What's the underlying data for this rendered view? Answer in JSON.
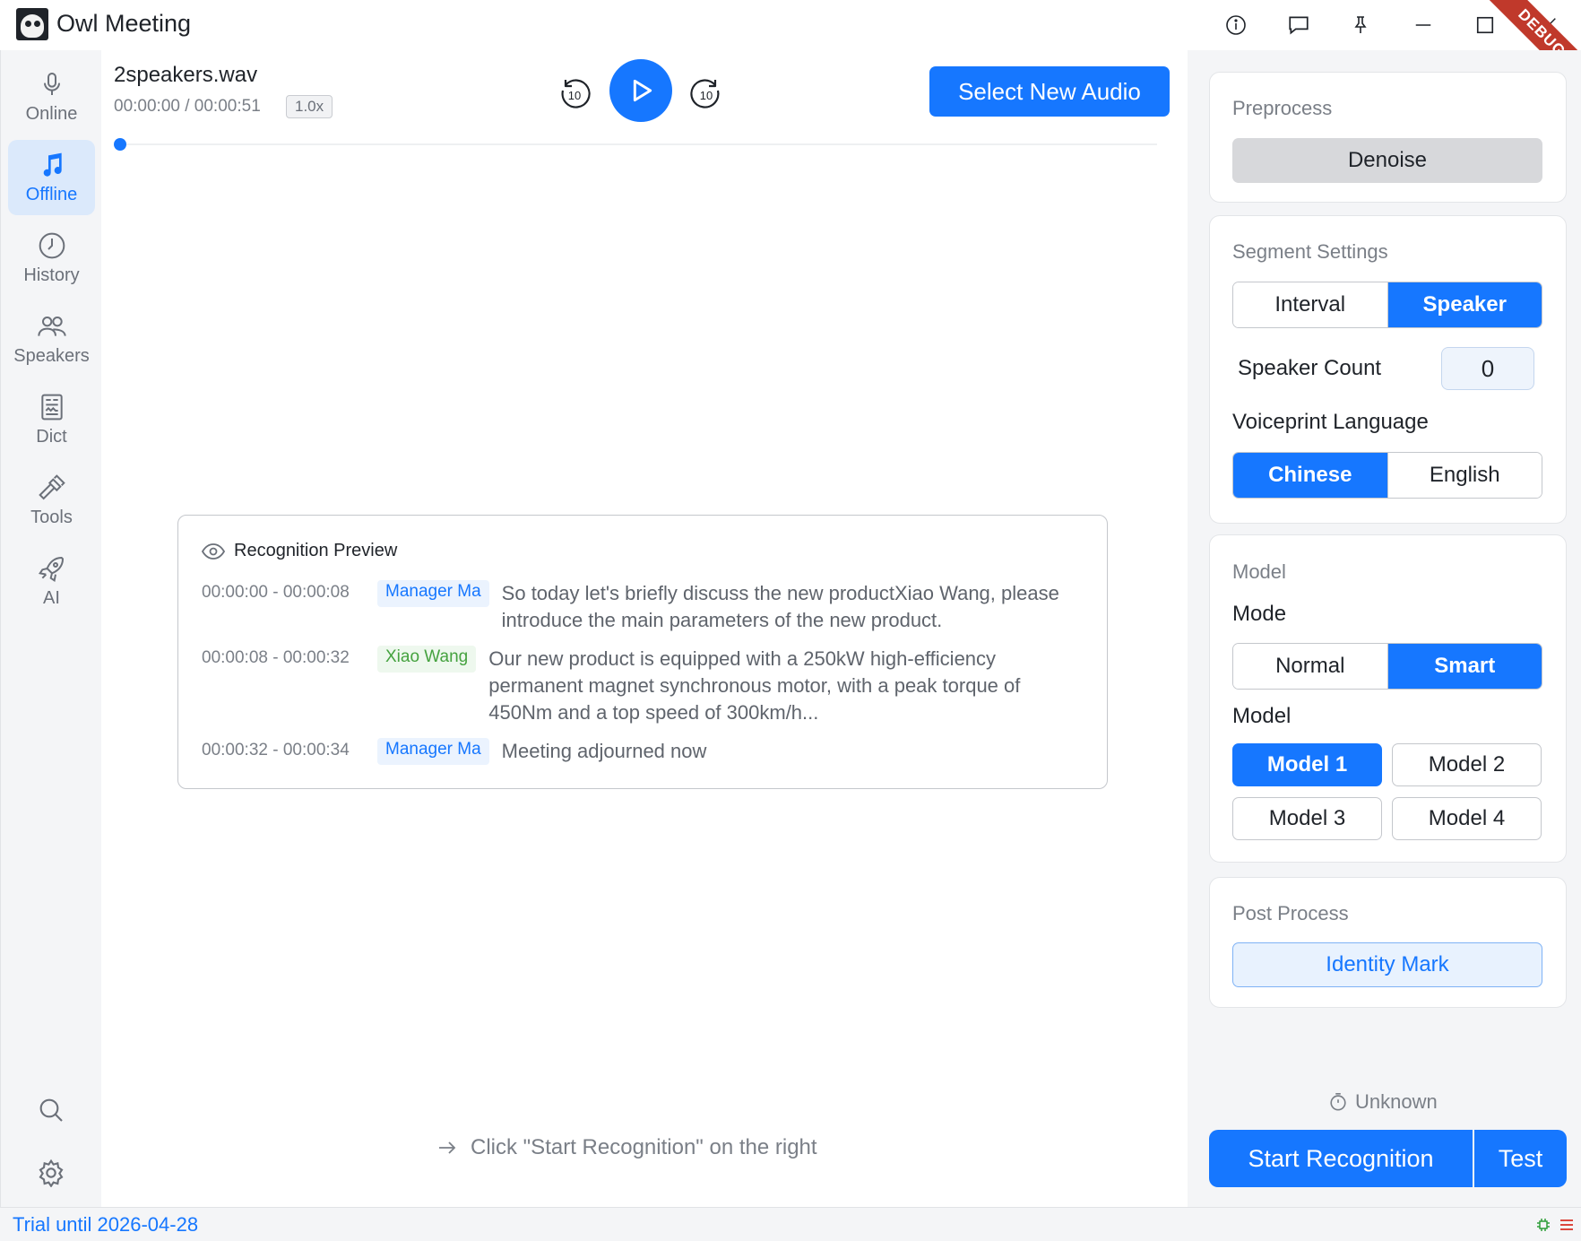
{
  "app": {
    "title": "Owl Meeting",
    "debug_label": "DEBUG"
  },
  "titlebar": {
    "icons": [
      "info-icon",
      "message-icon",
      "pin-icon",
      "minimize-icon",
      "maximize-icon",
      "close-icon"
    ]
  },
  "sidebar": {
    "items": [
      {
        "label": "Online",
        "icon": "microphone-icon",
        "active": false
      },
      {
        "label": "Offline",
        "icon": "music-note-icon",
        "active": true
      },
      {
        "label": "History",
        "icon": "clock-icon",
        "active": false
      },
      {
        "label": "Speakers",
        "icon": "users-icon",
        "active": false
      },
      {
        "label": "Dict",
        "icon": "dictionary-icon",
        "active": false
      },
      {
        "label": "Tools",
        "icon": "hammer-icon",
        "active": false
      },
      {
        "label": "AI",
        "icon": "rocket-icon",
        "active": false
      }
    ],
    "bottom_icons": [
      "search-icon",
      "settings-icon"
    ]
  },
  "player": {
    "file_name": "2speakers.wav",
    "time": "00:00:00 / 00:00:51",
    "speed": "1.0x",
    "skip_back_label": "10",
    "skip_forward_label": "10",
    "progress": 0,
    "select_audio_label": "Select New Audio"
  },
  "preview": {
    "title": "Recognition Preview",
    "segments": [
      {
        "time": "00:00:00 - 00:00:08",
        "speaker": "Manager Ma",
        "color": "blue",
        "text": "So today let's briefly discuss the new productXiao Wang, please introduce the main parameters of the new product."
      },
      {
        "time": "00:00:08 - 00:00:32",
        "speaker": "Xiao Wang",
        "color": "green",
        "text": "Our new product is equipped with a 250kW high-efficiency permanent magnet synchronous motor, with a peak torque of 450Nm and a top speed of 300km/h..."
      },
      {
        "time": "00:00:32 - 00:00:34",
        "speaker": "Manager Ma",
        "color": "blue",
        "text": "Meeting adjourned now"
      }
    ]
  },
  "hint": "Click \"Start Recognition\" on the right",
  "settings": {
    "preprocess": {
      "title": "Preprocess",
      "denoise_label": "Denoise"
    },
    "segment": {
      "title": "Segment Settings",
      "options": [
        "Interval",
        "Speaker"
      ],
      "selected": "Speaker",
      "speaker_count_label": "Speaker Count",
      "speaker_count_value": "0",
      "voiceprint_label": "Voiceprint Language",
      "languages": [
        "Chinese",
        "English"
      ],
      "selected_language": "Chinese"
    },
    "model": {
      "title": "Model",
      "mode_label": "Mode",
      "modes": [
        "Normal",
        "Smart"
      ],
      "selected_mode": "Smart",
      "model_label": "Model",
      "models": [
        "Model 1",
        "Model 2",
        "Model 3",
        "Model 4"
      ],
      "selected_model": "Model 1"
    },
    "post": {
      "title": "Post Process",
      "identity_label": "Identity Mark"
    },
    "duration": "Unknown",
    "start_label": "Start Recognition",
    "test_label": "Test"
  },
  "status": {
    "trial": "Trial until 2026-04-28"
  },
  "colors": {
    "accent": "#1677ff",
    "speaker_blue": "#1677ff",
    "speaker_green": "#45a23f"
  }
}
